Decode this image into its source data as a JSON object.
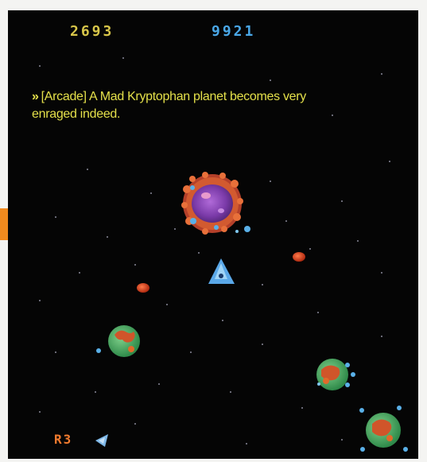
{
  "scores": {
    "player1": "2693",
    "player2": "9921"
  },
  "caption": {
    "bullet": "»",
    "text": "[Arcade] A Mad Kryptophan planet becomes very enraged indeed."
  },
  "hud": {
    "round_label": "R3",
    "lives_icon": "ship-icon"
  },
  "colors": {
    "score_p1": "#d8c64a",
    "score_p2": "#4aa8e8",
    "caption": "#e4e04a",
    "round": "#ef7a2e",
    "accent_tab": "#f08a1e"
  }
}
